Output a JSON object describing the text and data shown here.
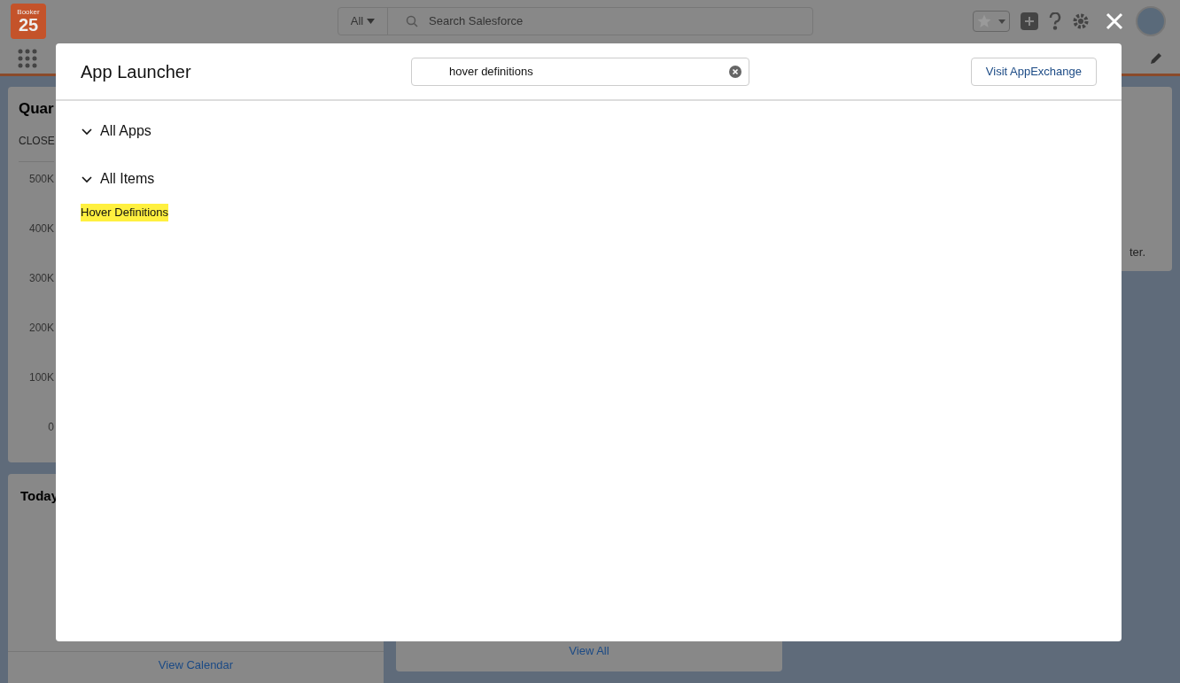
{
  "header": {
    "logo_top": "Booker",
    "logo_number": "25",
    "scope": "All",
    "search_placeholder": "Search Salesforce"
  },
  "cards": {
    "quarterly": {
      "title": "Quar",
      "subtitle": "CLOSE",
      "axis_labels": [
        "500K",
        "400K",
        "300K",
        "200K",
        "100K",
        "0"
      ]
    },
    "today": {
      "title": "Today",
      "footer_link": "View Calendar"
    },
    "middle": {
      "footer_link": "View All"
    },
    "right": {
      "text": "ter."
    }
  },
  "modal": {
    "title": "App Launcher",
    "search_value": "hover definitions",
    "action": "Visit AppExchange",
    "sections": [
      {
        "label": "All Apps",
        "expanded": true
      },
      {
        "label": "All Items",
        "expanded": true,
        "items": [
          {
            "label": "Hover Definitions",
            "highlighted": true
          }
        ]
      }
    ]
  }
}
